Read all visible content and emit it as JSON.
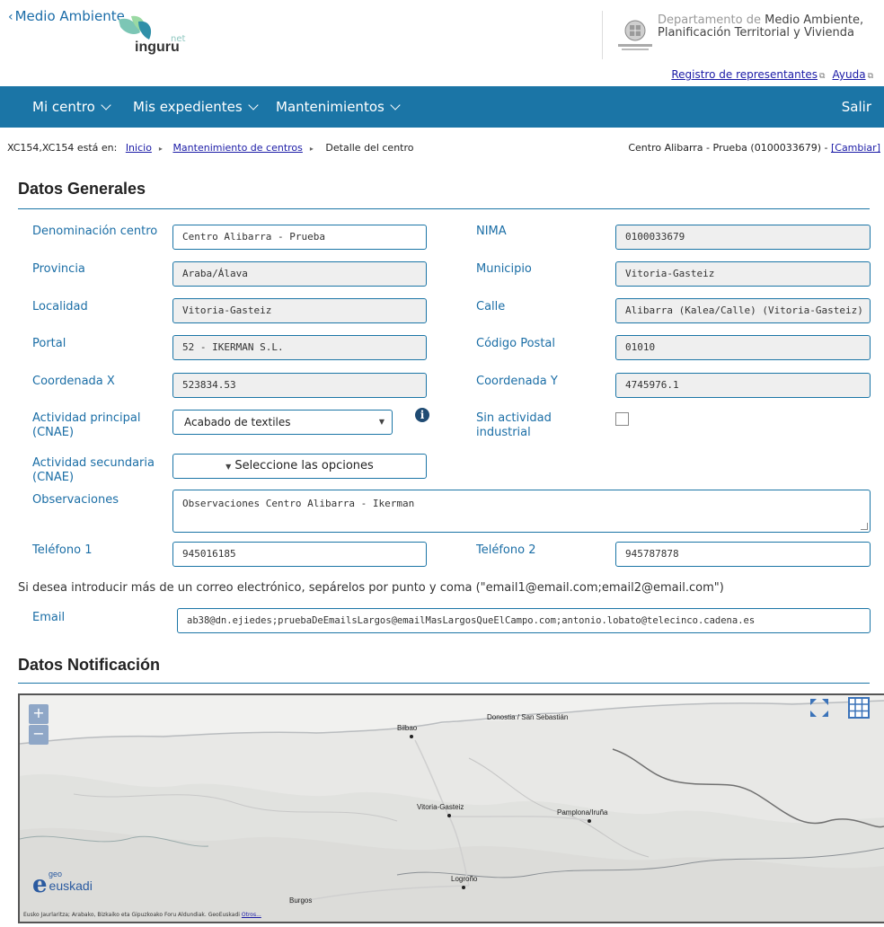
{
  "header": {
    "back_label": "Medio Ambiente",
    "logo_text": "inguru",
    "logo_sub": "net",
    "dept_line1_light": "Departamento de",
    "dept_line1": "Medio Ambiente,",
    "dept_line2": "Planificación Territorial y Vivienda",
    "link_registro": "Registro de representantes",
    "link_ayuda": "Ayuda"
  },
  "nav": {
    "mi_centro": "Mi centro",
    "mis_expedientes": "Mis expedientes",
    "mantenimientos": "Mantenimientos",
    "salir": "Salir"
  },
  "breadcrumb": {
    "prefix": "XC154,XC154 está en:",
    "inicio": "Inicio",
    "mantenimiento": "Mantenimiento de centros",
    "current": "Detalle del centro",
    "center_info": "Centro Alibarra - Prueba (0100033679) -",
    "cambiar": "[Cambiar]"
  },
  "datos_generales": {
    "title": "Datos Generales",
    "denominacion_label": "Denominación centro",
    "denominacion_value": "Centro Alibarra - Prueba",
    "nima_label": "NIMA",
    "nima_value": "0100033679",
    "provincia_label": "Provincia",
    "provincia_value": "Araba/Álava",
    "municipio_label": "Municipio",
    "municipio_value": "Vitoria-Gasteiz",
    "localidad_label": "Localidad",
    "localidad_value": "Vitoria-Gasteiz",
    "calle_label": "Calle",
    "calle_value": "Alibarra (Kalea/Calle) (Vitoria-Gasteiz)",
    "portal_label": "Portal",
    "portal_value": "52 - IKERMAN S.L.",
    "cp_label": "Código Postal",
    "cp_value": "01010",
    "coordx_label": "Coordenada X",
    "coordx_value": "523834.53",
    "coordy_label": "Coordenada Y",
    "coordy_value": "4745976.1",
    "actividad_label": "Actividad principal (CNAE)",
    "actividad_value": "Acabado de textiles",
    "sin_actividad_label": "Sin actividad industrial",
    "actividad_sec_label": "Actividad secundaria (CNAE)",
    "actividad_sec_value": "Seleccione las opciones",
    "observaciones_label": "Observaciones",
    "observaciones_value": "Observaciones Centro Alibarra - Ikerman",
    "telefono1_label": "Teléfono 1",
    "telefono1_value": "945016185",
    "telefono2_label": "Teléfono 2",
    "telefono2_value": "945787878",
    "email_hint": "Si desea introducir más de un correo electrónico, sepárelos por punto y coma (\"email1@email.com;email2@email.com\")",
    "email_label": "Email",
    "email_value": "ab38@dn.ejiedes;pruebaDeEmailsLargos@emailMasLargosQueElCampo.com;antonio.lobato@telecinco.cadena.es"
  },
  "datos_notificacion": {
    "title": "Datos Notificación"
  },
  "map": {
    "zoom_in": "+",
    "zoom_out": "−",
    "cities": [
      "Bilbao",
      "Donostia / San Sebastián",
      "Vitoria-Gasteiz",
      "Pamplona/Iruña",
      "Logroño",
      "Burgos"
    ],
    "logo_geo": "geo",
    "logo_main": "euskadi",
    "attribution": "Eusko Jaurlaritza; Arabako, Bizkaiko eta Gipuzkoako Foru Aldundiak. GeoEuskadi",
    "attribution_link": "Otros..."
  }
}
